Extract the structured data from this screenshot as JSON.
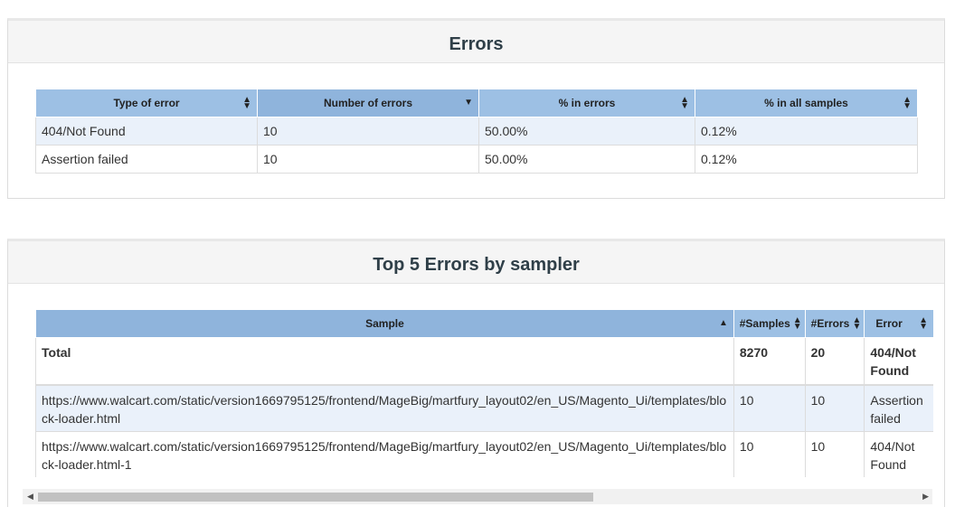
{
  "errors": {
    "title": "Errors",
    "columns": [
      "Type of error",
      "Number of errors",
      "% in errors",
      "% in all samples"
    ],
    "rows": [
      [
        "404/Not Found",
        "10",
        "50.00%",
        "0.12%"
      ],
      [
        "Assertion failed",
        "10",
        "50.00%",
        "0.12%"
      ]
    ]
  },
  "top5": {
    "title": "Top 5 Errors by sampler",
    "columns": [
      "Sample",
      "#Samples",
      "#Errors",
      "Error"
    ],
    "total": {
      "sample": "Total",
      "samples": "8270",
      "errors": "20",
      "error": "404/Not Found"
    },
    "rows": [
      {
        "sample": "https://www.walcart.com/static/version1669795125/frontend/MageBig/martfury_layout02/en_US/Magento_Ui/templates/block-loader.html",
        "samples": "10",
        "errors": "10",
        "error": "Assertion failed"
      },
      {
        "sample": "https://www.walcart.com/static/version1669795125/frontend/MageBig/martfury_layout02/en_US/Magento_Ui/templates/block-loader.html-1",
        "samples": "10",
        "errors": "10",
        "error": "404/Not Found"
      }
    ]
  },
  "icons": {
    "sort": "sort-both-icon",
    "sort_asc": "sort-asc-icon",
    "sort_desc": "sort-desc-icon",
    "scroll_left": "scroll-left-arrow-icon",
    "scroll_right": "scroll-right-arrow-icon"
  },
  "colors": {
    "header_bg": "#9dc0e4",
    "alt_row": "#eaf1fa",
    "title": "#2f3f48"
  }
}
